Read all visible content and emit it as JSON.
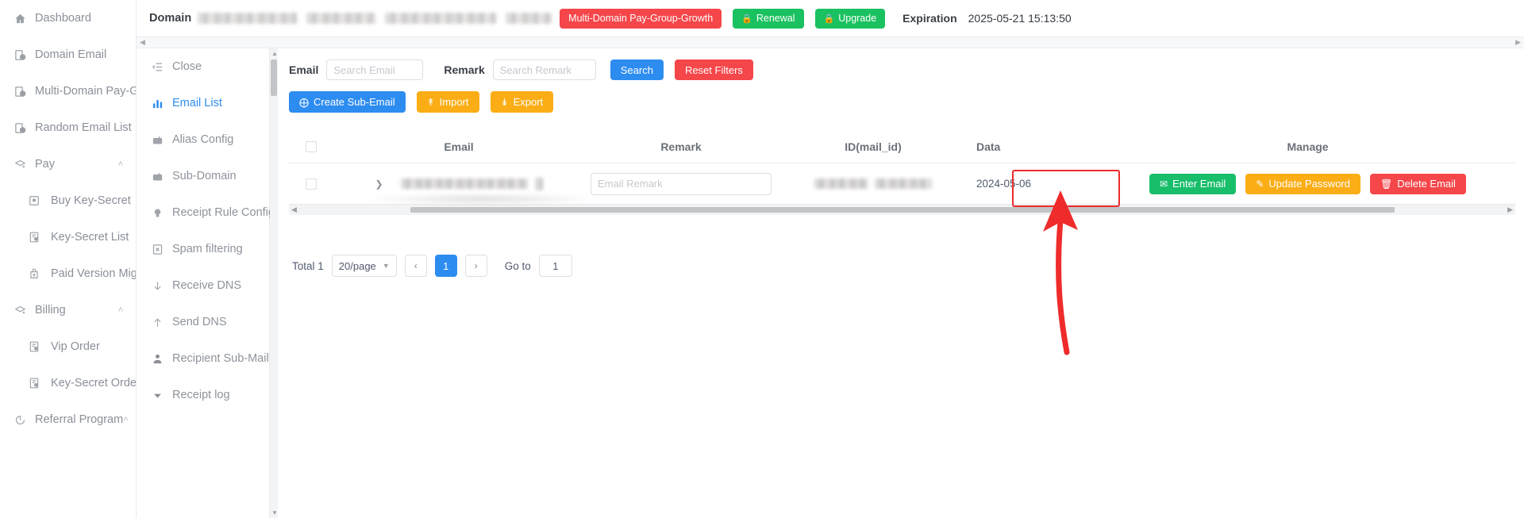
{
  "sidebar": {
    "items": [
      {
        "label": "Dashboard",
        "icon": "home-icon",
        "level": "top",
        "expandable": false
      },
      {
        "label": "Domain Email",
        "icon": "domain-email-icon",
        "level": "top",
        "expandable": false
      },
      {
        "label": "Multi-Domain Pay-Group",
        "icon": "multi-domain-icon",
        "level": "top",
        "expandable": false
      },
      {
        "label": "Random Email List",
        "icon": "random-email-icon",
        "level": "top",
        "expandable": false
      },
      {
        "label": "Pay",
        "icon": "pay-icon",
        "level": "top",
        "expandable": true,
        "caret": "˄"
      },
      {
        "label": "Buy Key-Secret",
        "icon": "buy-key-secret-icon",
        "level": "sub",
        "expandable": false
      },
      {
        "label": "Key-Secret List",
        "icon": "key-secret-list-icon",
        "level": "sub",
        "expandable": false
      },
      {
        "label": "Paid Version Migration",
        "icon": "paid-migration-icon",
        "level": "sub",
        "expandable": false
      },
      {
        "label": "Billing",
        "icon": "billing-icon",
        "level": "top",
        "expandable": true,
        "caret": "˄"
      },
      {
        "label": "Vip Order",
        "icon": "vip-order-icon",
        "level": "sub",
        "expandable": false
      },
      {
        "label": "Key-Secret Order",
        "icon": "key-secret-order-icon",
        "level": "sub",
        "expandable": false
      },
      {
        "label": "Referral Program",
        "icon": "referral-icon",
        "level": "top",
        "expandable": true,
        "caret": "˄"
      }
    ]
  },
  "header": {
    "domain_label": "Domain",
    "domain_values_redacted": [
      "",
      "",
      "",
      ""
    ],
    "pay_group_badge": "Multi-Domain Pay-Group-Growth",
    "renewal_button": "Renewal",
    "upgrade_button": "Upgrade",
    "expiration_label": "Expiration",
    "expiration_value": "2025-05-21 15:13:50"
  },
  "submenu": {
    "items": [
      {
        "label": "Close",
        "icon": "collapse-menu-icon",
        "active": false
      },
      {
        "label": "Email List",
        "icon": "bar-chart-icon",
        "active": true
      },
      {
        "label": "Alias Config",
        "icon": "alias-config-icon",
        "active": false
      },
      {
        "label": "Sub-Domain",
        "icon": "sub-domain-icon",
        "active": false
      },
      {
        "label": "Receipt Rule Config",
        "icon": "bulb-icon",
        "active": false
      },
      {
        "label": "Spam filtering",
        "icon": "spam-filter-icon",
        "active": false
      },
      {
        "label": "Receive DNS",
        "icon": "arrow-down-icon",
        "active": false
      },
      {
        "label": "Send DNS",
        "icon": "arrow-up-icon",
        "active": false
      },
      {
        "label": "Recipient Sub-Mail",
        "icon": "user-icon",
        "active": false
      },
      {
        "label": "Receipt log",
        "icon": "triangle-down-icon",
        "active": false
      }
    ]
  },
  "filters": {
    "email_label": "Email",
    "email_placeholder": "Search Email",
    "email_value": "",
    "remark_label": "Remark",
    "remark_placeholder": "Search Remark",
    "remark_value": "",
    "search_button": "Search",
    "reset_button": "Reset Filters"
  },
  "toolbar": {
    "create_button": "Create Sub-Email",
    "import_button": "Import",
    "export_button": "Export"
  },
  "table": {
    "columns": [
      "",
      "Email",
      "Remark",
      "ID(mail_id)",
      "Data",
      "Manage"
    ],
    "rows": [
      {
        "email": "",
        "remark_placeholder": "Email Remark",
        "remark_value": "",
        "mail_id": "",
        "date": "2024-05-06",
        "actions": {
          "enter_email": "Enter Email",
          "update_password": "Update Password",
          "delete_email": "Delete Email"
        }
      }
    ]
  },
  "pagination": {
    "total_label": "Total 1",
    "page_size": "20/page",
    "prev": "‹",
    "current_page": "1",
    "next": "›",
    "goto_label": "Go to",
    "goto_value": "1"
  },
  "annotation": {
    "highlight_target": "Update Password",
    "highlight_color": "#ef2b2b"
  },
  "colors": {
    "primary_blue": "#2d8cf0",
    "danger_red": "#f5464a",
    "success_green": "#19be6b",
    "warning_orange": "#fbad16",
    "annotation_red": "#ef2b2b"
  }
}
